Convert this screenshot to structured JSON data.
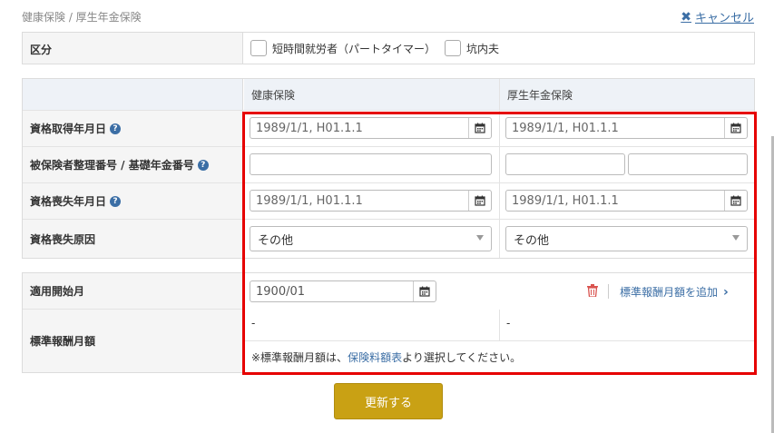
{
  "breadcrumb": "健康保険 / 厚生年金保険",
  "cancel_label": "キャンセル",
  "kubun": {
    "label": "区分",
    "options": [
      "短時間就労者（パートタイマー）",
      "坑内夫"
    ]
  },
  "table": {
    "col_kenko": "健康保険",
    "col_kosei": "厚生年金保険",
    "rows": {
      "shikaku_shutoku": {
        "label": "資格取得年月日",
        "kenko_placeholder": "1989/1/1, H01.1.1",
        "kosei_placeholder": "1989/1/1, H01.1.1"
      },
      "seiri_bango": {
        "label": "被保険者整理番号 / 基礎年金番号"
      },
      "shikaku_soshitsu": {
        "label": "資格喪失年月日",
        "kenko_placeholder": "1989/1/1, H01.1.1",
        "kosei_placeholder": "1989/1/1, H01.1.1"
      },
      "soshitsu_genin": {
        "label": "資格喪失原因",
        "kenko_value": "その他",
        "kosei_value": "その他"
      }
    }
  },
  "bottom": {
    "tekiyo_label": "適用開始月",
    "tekiyo_value": "1900/01",
    "add_label": "標準報酬月額を追加",
    "hyojun_label": "標準報酬月額",
    "kenko_value": "-",
    "kosei_value": "-",
    "note_prefix": "※標準報酬月額は、",
    "note_link": "保険料額表",
    "note_suffix": "より選択してください。"
  },
  "update_button": "更新する",
  "colors": {
    "accent": "#c9a114",
    "link": "#3b6ea5",
    "highlight": "#e60000"
  }
}
